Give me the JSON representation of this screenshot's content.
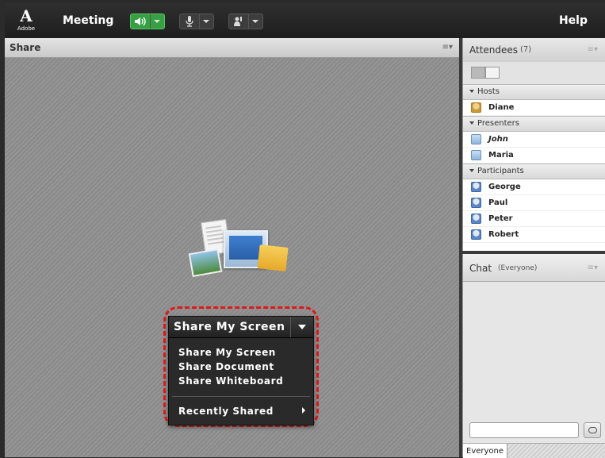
{
  "topbar": {
    "logo_text": "Adobe",
    "meeting_menu": "Meeting",
    "help_menu": "Help",
    "icons": [
      "speaker-icon",
      "microphone-icon",
      "raise-hand-icon"
    ],
    "speaker_active_color": "#36a043"
  },
  "share_pod": {
    "title": "Share",
    "menu_icon": "pod-options-icon",
    "share_button_label": "Share My Screen",
    "menu_items": [
      "Share My Screen",
      "Share Document",
      "Share Whiteboard"
    ],
    "recent_label": "Recently Shared",
    "highlight_color": "#e01818"
  },
  "attendees": {
    "title": "Attendees",
    "count": "(7)",
    "groups": {
      "hosts": "Hosts",
      "presenters": "Presenters",
      "participants": "Participants"
    },
    "hosts": [
      "Diane"
    ],
    "presenters": [
      "John",
      "Maria"
    ],
    "participants": [
      "George",
      "Paul",
      "Peter",
      "Robert"
    ]
  },
  "chat": {
    "title": "Chat",
    "audience": "(Everyone)",
    "tab": "Everyone"
  }
}
